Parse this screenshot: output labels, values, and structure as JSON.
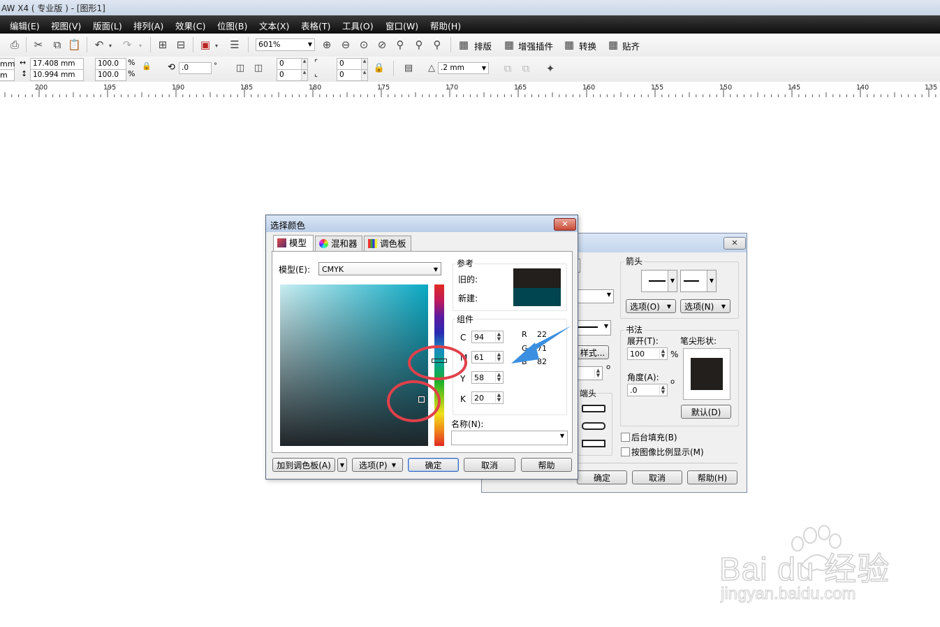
{
  "window": {
    "title": "AW X4 ( 专业版 ) - [图形1]"
  },
  "menu": [
    "编辑(E)",
    "视图(V)",
    "版面(L)",
    "排列(A)",
    "效果(C)",
    "位图(B)",
    "文本(X)",
    "表格(T)",
    "工具(O)",
    "窗口(W)",
    "帮助(H)"
  ],
  "toolbar": {
    "zoom": "601%",
    "buttons": [
      "排版",
      "增强插件",
      "转换",
      "贴齐"
    ]
  },
  "propbar": {
    "x_unit": "mm",
    "y_unit": "m",
    "width": "17.408 mm",
    "height": "10.994 mm",
    "scale_x": "100.0",
    "scale_y": "100.0",
    "pct1": "%",
    "pct2": "%",
    "angle": ".0",
    "deg": "°",
    "pos1": "0",
    "pos2": "0",
    "pos3": "0",
    "pos4": "0",
    "outline": ".2 mm"
  },
  "ruler": {
    "labels": [
      "200",
      "195",
      "190",
      "185",
      "180",
      "175",
      "170",
      "165",
      "160",
      "155",
      "150",
      "145",
      "140",
      "135"
    ]
  },
  "outline_dialog": {
    "arrows_label": "箭头",
    "options1": "选项(O)",
    "options2": "选项(N)",
    "calligraphy_label": "书法",
    "stretch_label": "展开(T):",
    "stretch_value": "100",
    "stretch_unit": "%",
    "nib_label": "笔尖形状:",
    "angle_label": "角度(A):",
    "angle_value": ".0",
    "angle_unit": "o",
    "default_btn": "默认(D)",
    "style_btn": "样式...",
    "end_label": "端头",
    "behind_fill": "后台填充(B)",
    "scale_with_image": "按图像比例显示(M)",
    "ok": "确定",
    "cancel": "取消",
    "help": "帮助(H)",
    "deg_mark": "o"
  },
  "color_dialog": {
    "title": "选择颜色",
    "tabs": [
      "模型",
      "混和器",
      "调色板"
    ],
    "model_label": "模型(E):",
    "model_value": "CMYK",
    "reference_label": "参考",
    "old_label": "旧的:",
    "new_label": "新建:",
    "old_color": "#231f1c",
    "new_color": "#00454f",
    "components_label": "组件",
    "cmyk": [
      {
        "label": "C",
        "value": "94"
      },
      {
        "label": "M",
        "value": "61"
      },
      {
        "label": "Y",
        "value": "58"
      },
      {
        "label": "K",
        "value": "20"
      }
    ],
    "rgb": [
      {
        "label": "R",
        "value": "22"
      },
      {
        "label": "G",
        "value": "71"
      },
      {
        "label": "B",
        "value": "82"
      }
    ],
    "name_label": "名称(N):",
    "add_palette": "加到调色板(A)",
    "options": "选项(P)",
    "ok": "确定",
    "cancel": "取消",
    "help": "帮助"
  },
  "watermark": {
    "brand": "Bai du 经验",
    "url": "jingyan.baidu.com"
  },
  "colors": {
    "annotation_red": "#e0404a",
    "annotation_blue": "#3b8fe0",
    "accent": "#0aa9c4"
  }
}
